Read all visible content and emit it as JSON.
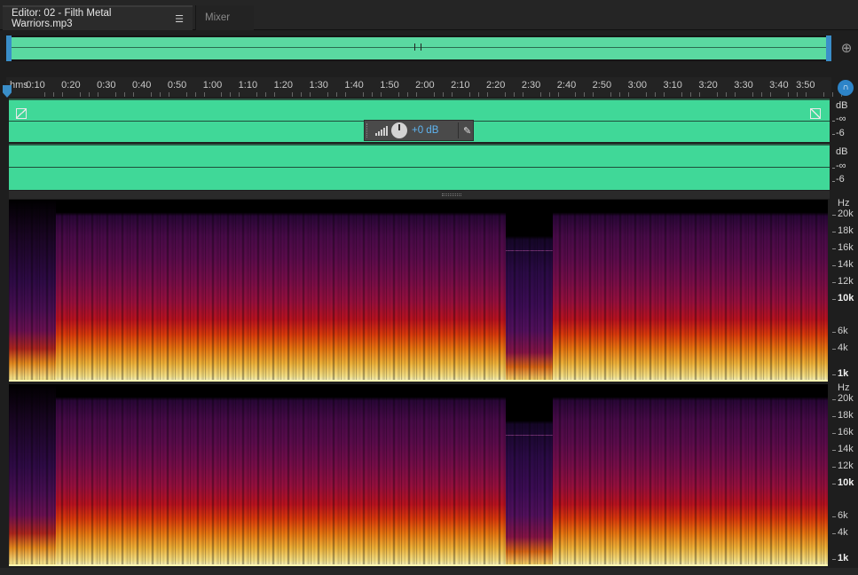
{
  "tabs": {
    "editor_label": "Editor: 02 - Filth Metal Warriors.mp3",
    "mixer_label": "Mixer"
  },
  "icons": {
    "panel_menu": "panel-menu-icon",
    "zoom": "zoom-icon",
    "monitor": "headphones-icon",
    "fade_in": "fade-in-icon",
    "fade_out": "fade-out-icon",
    "pin": "pin-icon"
  },
  "ruler": {
    "unit": "hms",
    "ticks": [
      "0:10",
      "0:20",
      "0:30",
      "0:40",
      "0:50",
      "1:00",
      "1:10",
      "1:20",
      "1:30",
      "1:40",
      "1:50",
      "2:00",
      "2:10",
      "2:20",
      "2:30",
      "2:40",
      "2:50",
      "3:00",
      "3:10",
      "3:20",
      "3:30",
      "3:40",
      "3:50"
    ]
  },
  "hud": {
    "gain_value": "+0 dB"
  },
  "db_scale": {
    "unit": "dB",
    "inf": "-∞",
    "minus6": "-6"
  },
  "hz_scale": {
    "unit": "Hz",
    "labels": [
      "20k",
      "18k",
      "16k",
      "14k",
      "12k",
      "10k",
      "6k",
      "4k",
      "1k"
    ]
  },
  "colors": {
    "waveform": "#40d898",
    "overview": "#5ad9a1",
    "accent_blue": "#3a8ec9",
    "hud_value": "#5fb4f0"
  }
}
